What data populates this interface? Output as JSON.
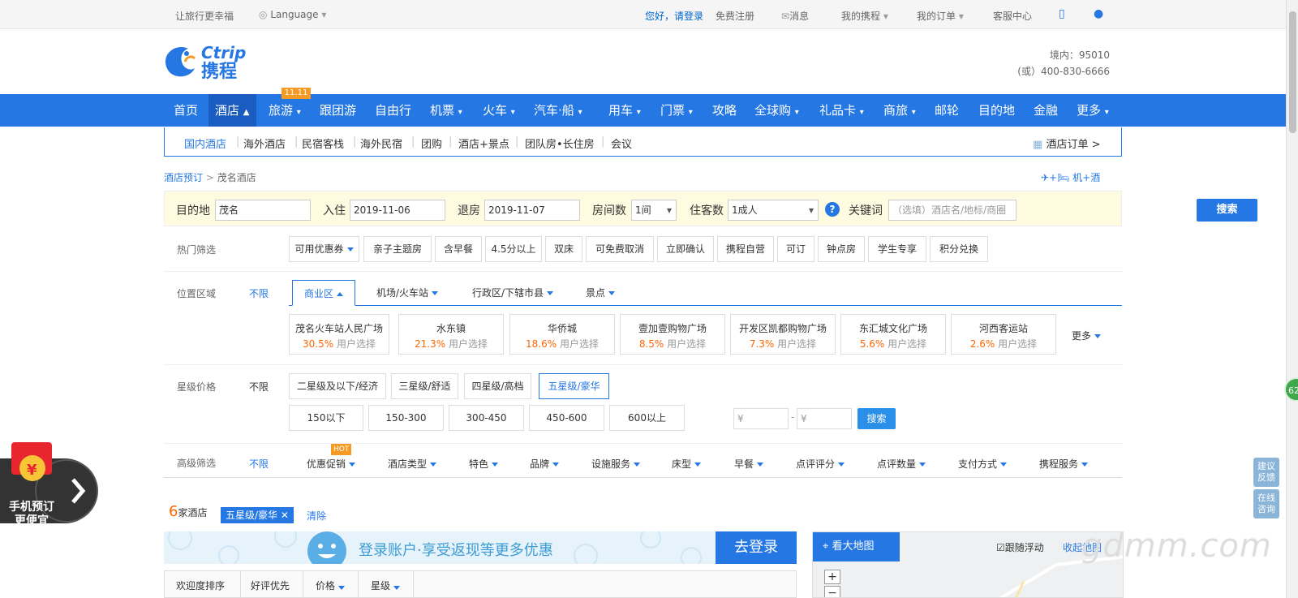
{
  "topbar": {
    "slogan": "让旅行更幸福",
    "language": "Language",
    "greeting": "您好，请登录",
    "register": "免费注册",
    "messages": "消息",
    "my_trips": "我的携程",
    "my_orders": "我的订单",
    "service": "客服中心"
  },
  "brand": {
    "name_en": "Ctrip",
    "name_cn": "携程"
  },
  "hotline": {
    "domestic": "境内：95010",
    "alt": "(或）400-830-6666"
  },
  "nav": {
    "badge": "11.11",
    "items": [
      "首页",
      "酒店",
      "旅游",
      "跟团游",
      "自由行",
      "机票",
      "火车",
      "汽车·船",
      "用车",
      "门票",
      "攻略",
      "全球购",
      "礼品卡",
      "商旅",
      "邮轮",
      "目的地",
      "金融",
      "更多"
    ]
  },
  "subnav": {
    "items": [
      "国内酒店",
      "海外酒店",
      "民宿客栈",
      "海外民宿",
      "团购",
      "酒店+景点",
      "团队房•长住房",
      "会议"
    ],
    "orders": "酒店订单 >"
  },
  "breadcrumb": {
    "root": "酒店预订",
    "sep": ">",
    "current": "茂名酒店"
  },
  "fly_hotel": "机+酒",
  "search": {
    "dest_label": "目的地",
    "dest_value": "茂名",
    "checkin_label": "入住",
    "checkin_value": "2019-11-06",
    "checkout_label": "退房",
    "checkout_value": "2019-11-07",
    "rooms_label": "房间数",
    "rooms_value": "1间",
    "guests_label": "住客数",
    "guests_value": "1成人",
    "keyword_label": "关键词",
    "keyword_placeholder": "（选填）酒店名/地标/商圈",
    "button": "搜索"
  },
  "hot_filters": {
    "label": "热门筛选",
    "items": [
      "可用优惠券",
      "亲子主题房",
      "含早餐",
      "4.5分以上",
      "双床",
      "可免费取消",
      "立即确认",
      "携程自营",
      "可订",
      "钟点房",
      "学生专享",
      "积分兑换"
    ]
  },
  "location": {
    "label": "位置区域",
    "unlimited": "不限",
    "tabs": [
      "商业区",
      "机场/火车站",
      "行政区/下辖市县",
      "景点"
    ],
    "areas": [
      {
        "name": "茂名火车站人民广场",
        "pct": "30.5%",
        "note": "用户选择"
      },
      {
        "name": "水东镇",
        "pct": "21.3%",
        "note": "用户选择"
      },
      {
        "name": "华侨城",
        "pct": "18.6%",
        "note": "用户选择"
      },
      {
        "name": "壹加壹购物广场",
        "pct": "8.5%",
        "note": "用户选择"
      },
      {
        "name": "开发区凯都购物广场",
        "pct": "7.3%",
        "note": "用户选择"
      },
      {
        "name": "东汇城文化广场",
        "pct": "5.6%",
        "note": "用户选择"
      },
      {
        "name": "河西客运站",
        "pct": "2.6%",
        "note": "用户选择"
      }
    ],
    "more": "更多"
  },
  "star_price": {
    "label": "星级价格",
    "unlimited": "不限",
    "stars": [
      "二星级及以下/经济",
      "三星级/舒适",
      "四星级/高档",
      "五星级/豪华"
    ],
    "prices": [
      "150以下",
      "150-300",
      "300-450",
      "450-600",
      "600以上"
    ],
    "min_placeholder": "¥",
    "max_placeholder": "¥",
    "dash": "-",
    "button": "搜索"
  },
  "advanced": {
    "label": "高级筛选",
    "unlimited": "不限",
    "hot_badge": "HOT",
    "items": [
      "优惠促销",
      "酒店类型",
      "特色",
      "品牌",
      "设施服务",
      "床型",
      "早餐",
      "点评评分",
      "点评数量",
      "支付方式",
      "携程服务"
    ]
  },
  "results": {
    "count": "6",
    "count_label": "家酒店",
    "selected_tag": "五星级/豪华",
    "clear": "清除"
  },
  "login_banner": {
    "text": "登录账户·享受返现等更多优惠",
    "button": "去登录"
  },
  "sort_tabs": [
    "欢迎度排序",
    "好评优先",
    "价格",
    "星级"
  ],
  "map": {
    "button": "看大地图",
    "follow": "跟随浮动",
    "collapse": "收起地图",
    "zoom_in": "+",
    "zoom_out": "−"
  },
  "promo": {
    "line1": "手机预订",
    "line2": "更便宜"
  },
  "side": {
    "feedback": "建议反馈",
    "consult": "在线咨询",
    "counter": "62"
  },
  "watermark": "gdmm.com",
  "colors": {
    "brand": "#2577e3",
    "accent": "#ff6600",
    "nav_active": "#1a5cc0",
    "search_bg": "#fffbe1"
  }
}
